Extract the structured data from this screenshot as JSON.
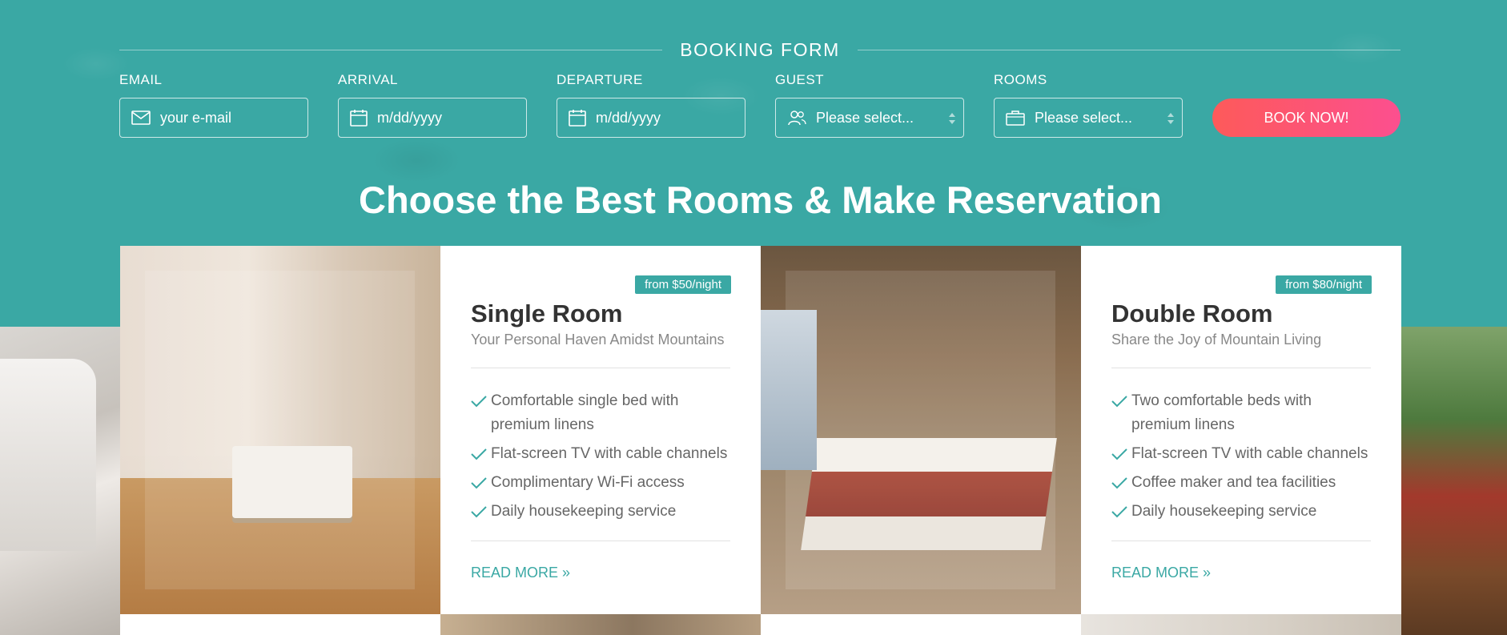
{
  "booking_form": {
    "title": "BOOKING FORM",
    "fields": [
      {
        "label": "EMAIL",
        "placeholder": "your e-mail",
        "icon": "envelope-icon"
      },
      {
        "label": "ARRIVAL",
        "placeholder": "m/dd/yyyy",
        "icon": "calendar-icon"
      },
      {
        "label": "DEPARTURE",
        "placeholder": "m/dd/yyyy",
        "icon": "calendar-icon"
      },
      {
        "label": "GUEST",
        "value": "Please select...",
        "icon": "users-icon"
      },
      {
        "label": "ROOMS",
        "value": "Please select...",
        "icon": "suitcase-icon"
      }
    ],
    "submit_label": "BOOK NOW!"
  },
  "heading": "Choose the Best Rooms & Make Reservation",
  "rooms": [
    {
      "price": "from $50/night",
      "title": "Single Room",
      "subtitle": "Your Personal Haven Amidst Mountains",
      "features": [
        "Comfortable single bed with premium linens",
        "Flat-screen TV with cable channels",
        "Complimentary Wi-Fi access",
        "Daily housekeeping service"
      ],
      "read_more": "READ MORE »"
    },
    {
      "price": "from $80/night",
      "title": "Double Room",
      "subtitle": "Share the Joy of Mountain Living",
      "features": [
        "Two comfortable beds with premium linens",
        "Flat-screen TV with cable channels",
        "Coffee maker and tea facilities",
        "Daily housekeeping service"
      ],
      "read_more": "READ MORE »"
    }
  ],
  "colors": {
    "accent": "#3aa8a4",
    "button_start": "#fd5a5a",
    "button_end": "#fc4f8f"
  }
}
